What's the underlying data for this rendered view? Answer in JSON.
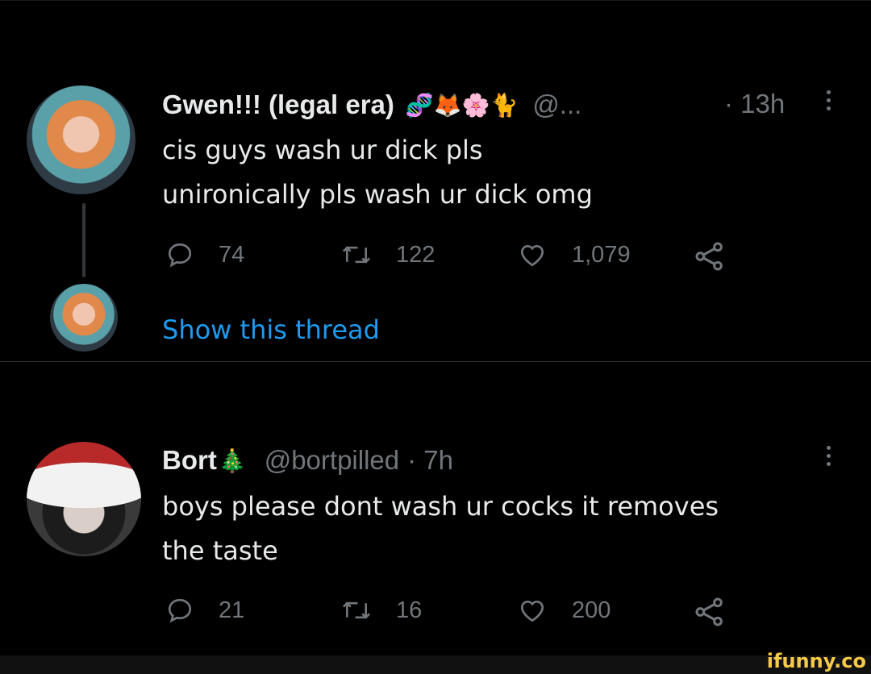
{
  "tweet1": {
    "name": "Gwen!!! (legal era)",
    "emojis": "🧬🦊🌸🐈",
    "handle": "@...",
    "time": "· 13h",
    "lines": [
      "cis guys wash ur dick pls",
      "unironically pls wash ur dick omg"
    ],
    "replies": "74",
    "retweets": "122",
    "likes": "1,079",
    "show_thread": "Show this thread"
  },
  "tweet2": {
    "name": "Bort",
    "emoji": "🎄",
    "handle": "@bortpilled",
    "time": "· 7h",
    "lines": [
      "boys please dont wash ur cocks it removes",
      "the taste"
    ],
    "replies": "21",
    "retweets": "16",
    "likes": "200"
  },
  "watermark": "ifunny.co",
  "colors": {
    "background": "#000000",
    "text": "#e7e9ea",
    "muted": "#71767b",
    "link": "#1d9bf0",
    "watermark": "#f7c948"
  },
  "icons": [
    "reply-icon",
    "retweet-icon",
    "like-icon",
    "share-icon",
    "more-icon"
  ]
}
